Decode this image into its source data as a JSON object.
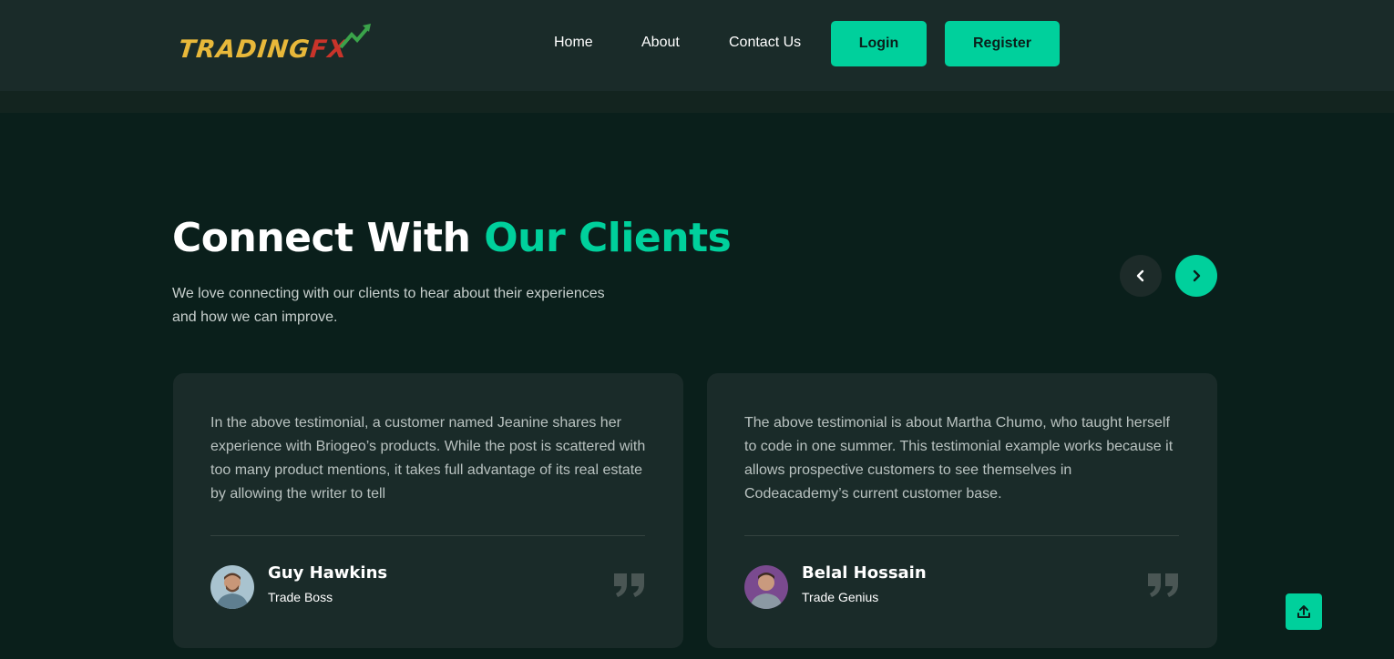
{
  "brand": {
    "logo_text_main": "TRADING",
    "logo_text_accent": "FX",
    "accent_color": "#00d09c"
  },
  "nav": {
    "items": [
      {
        "label": "Home"
      },
      {
        "label": "About"
      },
      {
        "label": "Contact Us"
      }
    ],
    "login_label": "Login",
    "register_label": "Register"
  },
  "section": {
    "title_main": "Connect With ",
    "title_accent": "Our Clients",
    "description": "We love connecting with our clients to hear about their experiences and how we can improve.",
    "prev_icon": "chevron-left-icon",
    "next_icon": "chevron-right-icon"
  },
  "testimonials": [
    {
      "text": "In the above testimonial, a customer named Jeanine shares her experience with Briogeo’s products. While the post is scattered with too many product mentions, it takes full advantage of its real estate by allowing the writer to tell",
      "name": "Guy Hawkins",
      "role": "Trade Boss"
    },
    {
      "text": "The above testimonial is about Martha Chumo, who taught herself to code in one summer. This testimonial example works because it allows prospective customers to see themselves in Codeacademy’s current customer base.",
      "name": "Belal Hossain",
      "role": "Trade Genius"
    }
  ],
  "scroll_top_icon": "upload-icon"
}
